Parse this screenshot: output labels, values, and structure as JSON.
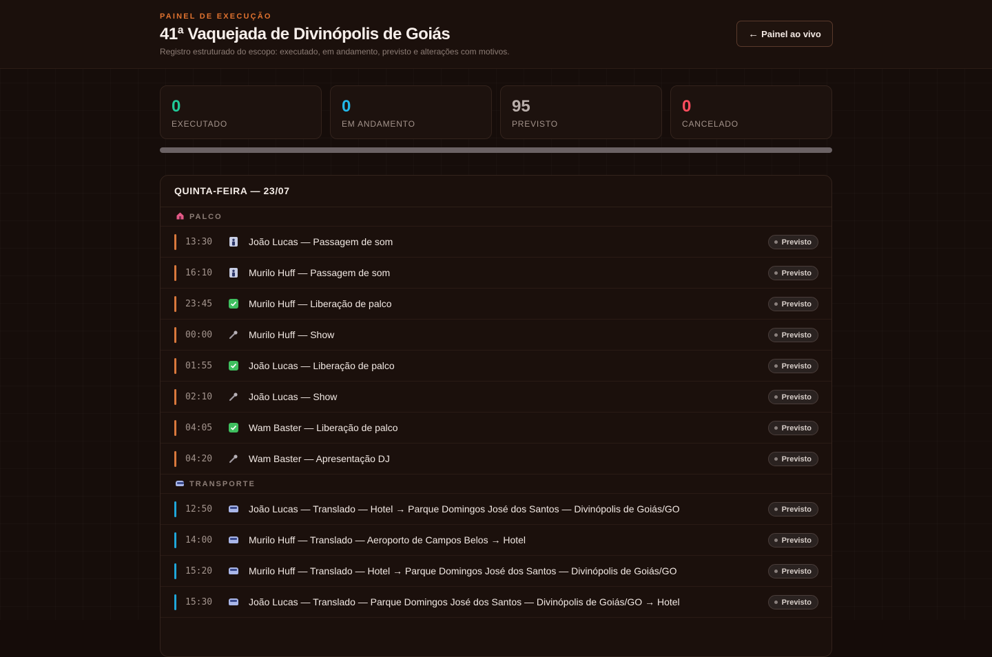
{
  "header": {
    "eyebrow": "PAINEL DE EXECUÇÃO",
    "title": "41ª Vaquejada de Divinópolis de Goiás",
    "subtitle": "Registro estruturado do escopo: executado, em andamento, previsto e alterações com motivos.",
    "live_button_label": "Painel ao vivo",
    "live_button_icon": "arrow-left-icon"
  },
  "stats": [
    {
      "value": "0",
      "label": "EXECUTADO",
      "color": "#20c997"
    },
    {
      "value": "0",
      "label": "EM ANDAMENTO",
      "color": "#22b8e8"
    },
    {
      "value": "95",
      "label": "PREVISTO",
      "color": "#b9aeaa"
    },
    {
      "value": "0",
      "label": "CANCELADO",
      "color": "#ff4d5e"
    }
  ],
  "progress": {
    "executed_fraction": 0
  },
  "day": {
    "title": "QUINTA-FEIRA — 23/07",
    "groups": [
      {
        "name": "PALCO",
        "icon": "stage-icon",
        "accent": "#d9783c",
        "items": [
          {
            "time": "13:30",
            "icon": "person-icon",
            "text": "João Lucas — Passagem de som",
            "status": "Previsto"
          },
          {
            "time": "16:10",
            "icon": "person-icon",
            "text": "Murilo Huff — Passagem de som",
            "status": "Previsto"
          },
          {
            "time": "23:45",
            "icon": "check-icon",
            "text": "Murilo Huff — Liberação de palco",
            "status": "Previsto"
          },
          {
            "time": "00:00",
            "icon": "microphone-icon",
            "text": "Murilo Huff — Show",
            "status": "Previsto"
          },
          {
            "time": "01:55",
            "icon": "check-icon",
            "text": "João Lucas — Liberação de palco",
            "status": "Previsto"
          },
          {
            "time": "02:10",
            "icon": "microphone-icon",
            "text": "João Lucas — Show",
            "status": "Previsto"
          },
          {
            "time": "04:05",
            "icon": "check-icon",
            "text": "Wam Baster — Liberação de palco",
            "status": "Previsto"
          },
          {
            "time": "04:20",
            "icon": "microphone-icon",
            "text": "Wam Baster — Apresentação DJ",
            "status": "Previsto"
          }
        ]
      },
      {
        "name": "TRANSPORTE",
        "icon": "bus-icon",
        "accent": "#1fa6d9",
        "items": [
          {
            "time": "12:50",
            "icon": "bus-icon",
            "text": "João Lucas — Translado — Hotel → Parque Domingos José dos Santos — Divinópolis de Goiás/GO",
            "status": "Previsto"
          },
          {
            "time": "14:00",
            "icon": "bus-icon",
            "text": "Murilo Huff — Translado — Aeroporto de Campos Belos → Hotel",
            "status": "Previsto"
          },
          {
            "time": "15:20",
            "icon": "bus-icon",
            "text": "Murilo Huff — Translado — Hotel → Parque Domingos José dos Santos — Divinópolis de Goiás/GO",
            "status": "Previsto"
          },
          {
            "time": "15:30",
            "icon": "bus-icon",
            "text": "João Lucas — Translado — Parque Domingos José dos Santos — Divinópolis de Goiás/GO → Hotel",
            "status": "Previsto"
          }
        ]
      }
    ]
  }
}
